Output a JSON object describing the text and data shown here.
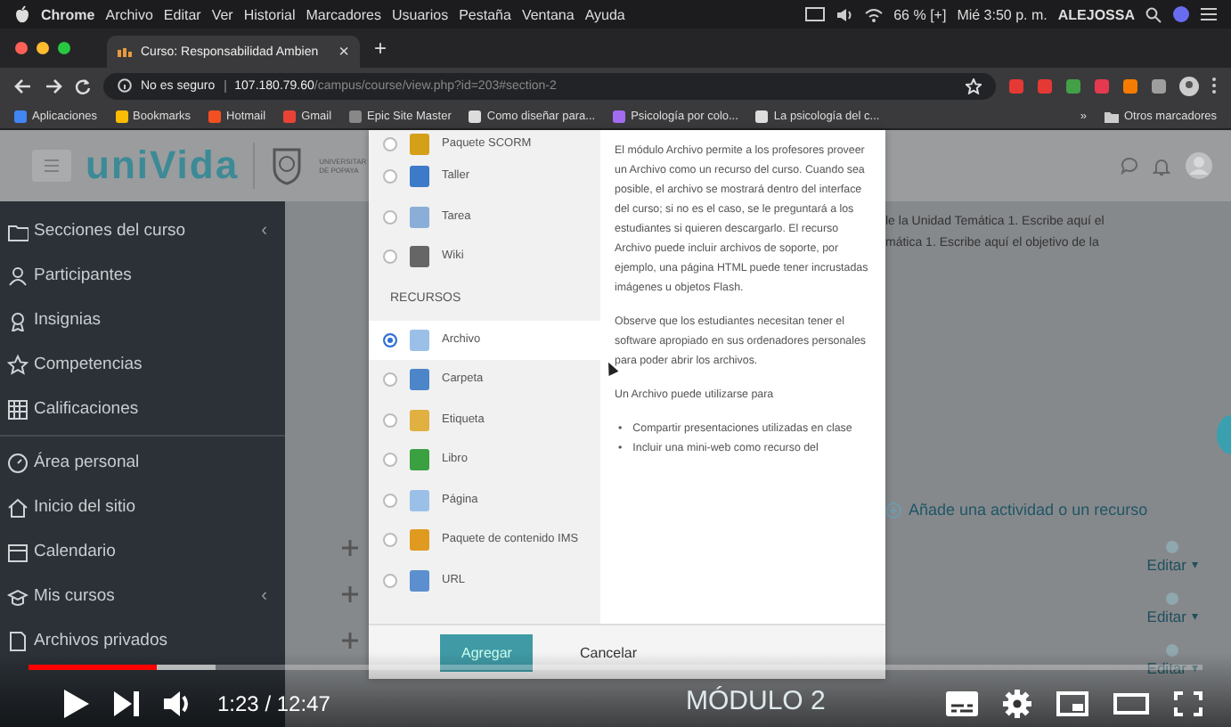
{
  "menu_bar": {
    "app": "Chrome",
    "items": [
      "Archivo",
      "Editar",
      "Ver",
      "Historial",
      "Marcadores",
      "Usuarios",
      "Pestaña",
      "Ventana",
      "Ayuda"
    ],
    "battery": "66 % [+]",
    "clock": "Mié 3:50 p. m.",
    "user": "ALEJOSSA"
  },
  "browser": {
    "tab_title": "Curso: Responsabilidad Ambien",
    "tab_close": "×",
    "new_tab": "+",
    "security": "No es seguro",
    "url_host": "107.180.79.60",
    "url_path": "/campus/course/view.php?id=203#section-2",
    "bookmarks": [
      "Aplicaciones",
      "Bookmarks",
      "Hotmail",
      "Gmail",
      "Epic Site Master",
      "Como diseñar para...",
      "Psicología por colo...",
      "La psicología del c..."
    ],
    "more_bookmarks": "»",
    "other_bookmarks": "Otros marcadores"
  },
  "site": {
    "logo": "uniVida",
    "institution": [
      "UNIVERSITAR",
      "DE POPAYA"
    ]
  },
  "sidebar": {
    "items": [
      {
        "label": "Secciones del curso",
        "chevron": "‹"
      },
      {
        "label": "Participantes"
      },
      {
        "label": "Insignias"
      },
      {
        "label": "Competencias"
      },
      {
        "label": "Calificaciones"
      },
      {
        "label": "Área personal"
      },
      {
        "label": "Inicio del sitio"
      },
      {
        "label": "Calendario"
      },
      {
        "label": "Mis cursos",
        "chevron": "‹"
      },
      {
        "label": "Archivos privados"
      }
    ]
  },
  "course": {
    "text_lines": [
      "le la Unidad Temática 1. Escribe aquí el",
      "mática 1. Escribe aquí el objetivo de la"
    ],
    "add_activity": "Añade una actividad o un recurso",
    "edit_links": [
      "Editar",
      "Editar",
      "Editar"
    ],
    "edit_caret": "▾",
    "module_heading": "MÓDULO 2"
  },
  "modal": {
    "options": [
      {
        "kind": "option",
        "label": "Paquete SCORM",
        "selected": false
      },
      {
        "kind": "option",
        "label": "Taller",
        "selected": false
      },
      {
        "kind": "option",
        "label": "Tarea",
        "selected": false
      },
      {
        "kind": "option",
        "label": "Wiki",
        "selected": false
      },
      {
        "kind": "heading",
        "label": "RECURSOS"
      },
      {
        "kind": "option",
        "label": "Archivo",
        "selected": true
      },
      {
        "kind": "option",
        "label": "Carpeta",
        "selected": false
      },
      {
        "kind": "option",
        "label": "Etiqueta",
        "selected": false
      },
      {
        "kind": "option",
        "label": "Libro",
        "selected": false
      },
      {
        "kind": "option",
        "label": "Página",
        "selected": false
      },
      {
        "kind": "option",
        "label": "Paquete de contenido IMS",
        "selected": false
      },
      {
        "kind": "option",
        "label": "URL",
        "selected": false
      }
    ],
    "description": [
      "El módulo Archivo permite a los profesores proveer un Archivo como un recurso del curso. Cuando sea posible, el archivo se mostrará dentro del interface del curso; si no es el caso, se le preguntará a los estudiantes si quieren descargarlo. El recurso Archivo puede incluir archivos de soporte, por ejemplo, una página HTML puede tener incrustadas imágenes u objetos Flash.",
      "Observe que los estudiantes necesitan tener el software apropiado en sus ordenadores personales para poder abrir los archivos.",
      "Un Archivo puede utilizarse para"
    ],
    "bullet_marker": "•",
    "bullets": [
      "Compartir presentaciones utilizadas en clase",
      "Incluir una mini-web como recurso del"
    ],
    "buttons": [
      "Agregar",
      "Cancelar"
    ]
  },
  "player": {
    "progress": {
      "level": 0.11
    },
    "buffered": {
      "level": 0.16
    },
    "time": "1:23 / 12:47"
  }
}
